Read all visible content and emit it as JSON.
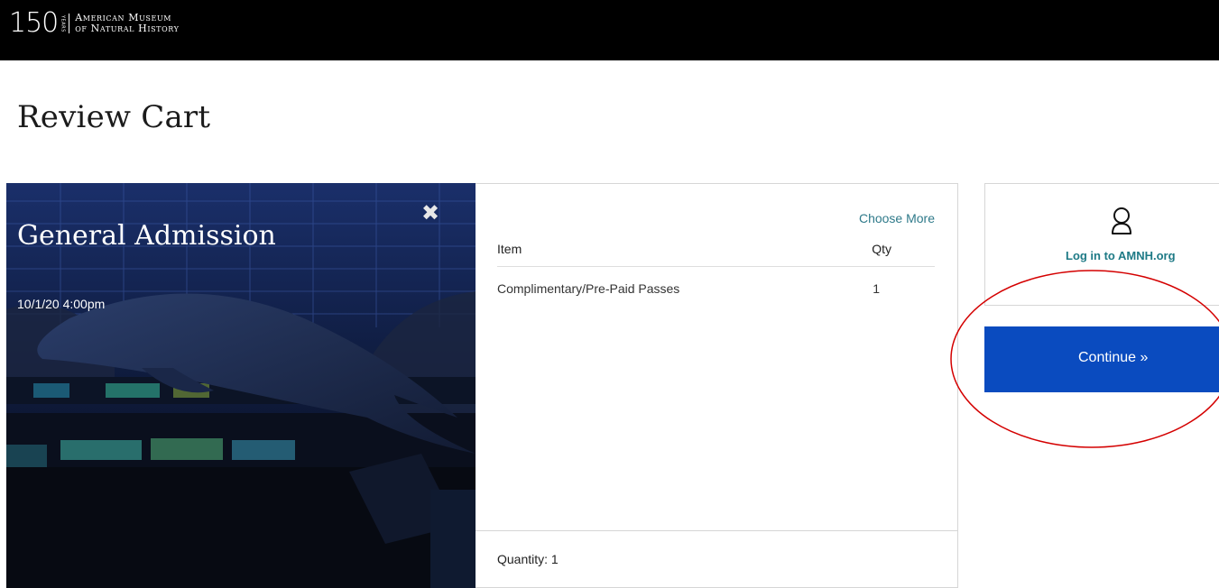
{
  "header": {
    "logo_number": "150",
    "logo_years": "YEARS",
    "logo_line1": "American Museum",
    "logo_line2": "of Natural History"
  },
  "page": {
    "title": "Review Cart"
  },
  "event": {
    "name": "General Admission",
    "datetime": "10/1/20 4:00pm"
  },
  "cart": {
    "choose_more": "Choose More",
    "col_item": "Item",
    "col_qty": "Qty",
    "items": [
      {
        "name": "Complimentary/Pre-Paid Passes",
        "qty": "1"
      }
    ],
    "quantity_label": "Quantity: 1"
  },
  "account": {
    "login_label": "Log in to AMNH.org"
  },
  "actions": {
    "continue_label": "Continue »"
  },
  "colors": {
    "accent_teal": "#1e7a86",
    "button_blue": "#0a4bbf",
    "annotation_red": "#d40000"
  }
}
